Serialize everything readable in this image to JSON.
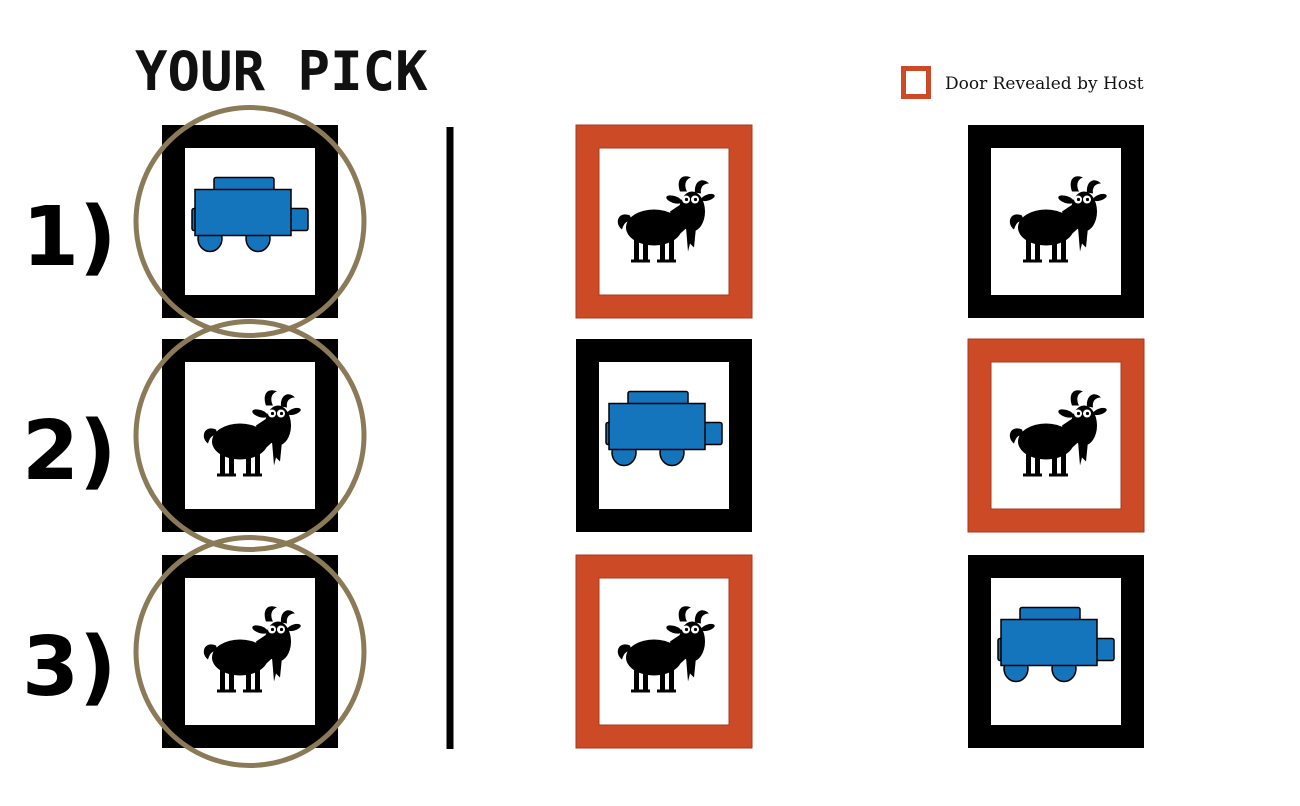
{
  "title": "YOUR PICK",
  "legend": {
    "label": "Door Revealed by Host",
    "color": "#cc4a26"
  },
  "colors": {
    "door_frame": "#000000",
    "revealed_frame": "#cc4a26",
    "pick_circle": "#8b7a57",
    "car": "#1475bd",
    "goat": "#000000"
  },
  "rows": [
    {
      "label": "1)",
      "pick": {
        "content": "car"
      },
      "doors": [
        {
          "content": "goat",
          "revealed": true
        },
        {
          "content": "goat",
          "revealed": false
        }
      ]
    },
    {
      "label": "2)",
      "pick": {
        "content": "goat"
      },
      "doors": [
        {
          "content": "car",
          "revealed": false
        },
        {
          "content": "goat",
          "revealed": true
        }
      ]
    },
    {
      "label": "3)",
      "pick": {
        "content": "goat"
      },
      "doors": [
        {
          "content": "goat",
          "revealed": true
        },
        {
          "content": "car",
          "revealed": false
        }
      ]
    }
  ]
}
